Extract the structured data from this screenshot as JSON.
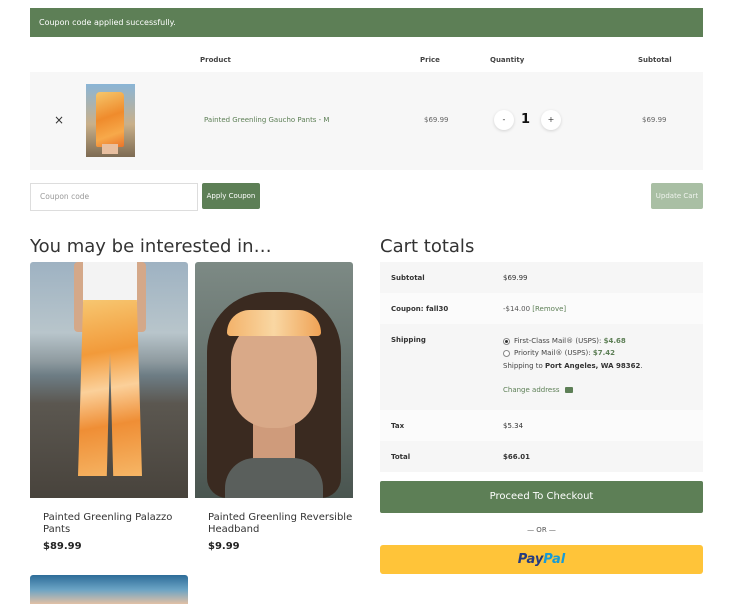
{
  "notice": {
    "text": "Coupon code applied successfully."
  },
  "cart_table": {
    "headers": {
      "product": "Product",
      "price": "Price",
      "quantity": "Quantity",
      "subtotal": "Subtotal"
    },
    "rows": [
      {
        "remove": "×",
        "name": "Painted Greenling Gaucho Pants - M",
        "price": "$69.99",
        "qty_minus": "-",
        "quantity": "1",
        "qty_plus": "+",
        "subtotal": "$69.99"
      }
    ]
  },
  "coupon": {
    "placeholder": "Coupon code",
    "apply_label": "Apply Coupon",
    "update_label": "Update Cart"
  },
  "interest": {
    "heading": "You may be interested in…",
    "products": [
      {
        "name": "Painted Greenling Palazzo Pants",
        "price": "$89.99"
      },
      {
        "name": "Painted Greenling Reversible Headband",
        "price": "$9.99"
      }
    ]
  },
  "totals": {
    "heading": "Cart totals",
    "subtotal_label": "Subtotal",
    "subtotal_value": "$69.99",
    "coupon_label": "Coupon: fall30",
    "coupon_value": "-$14.00",
    "coupon_remove": "[Remove]",
    "shipping_label": "Shipping",
    "shipping_options": [
      {
        "name": "First-Class Mail® (USPS):",
        "price": "$4.68",
        "selected": true
      },
      {
        "name": "Priority Mail® (USPS):",
        "price": "$7.42",
        "selected": false
      }
    ],
    "ship_to_prefix": "Shipping to",
    "ship_to_place": "Port Angeles, WA 98362",
    "change_address": "Change address",
    "tax_label": "Tax",
    "tax_value": "$5.34",
    "total_label": "Total",
    "total_value": "$66.01"
  },
  "checkout": {
    "label": "Proceed To Checkout",
    "or_text": "— OR —",
    "paypal_a": "Pay",
    "paypal_b": "Pal"
  },
  "colors": {
    "brand_green": "#5d7f56",
    "paypal_yellow": "#ffc439"
  },
  "icons": {
    "remove": "close-icon",
    "change_address": "truck-icon"
  }
}
